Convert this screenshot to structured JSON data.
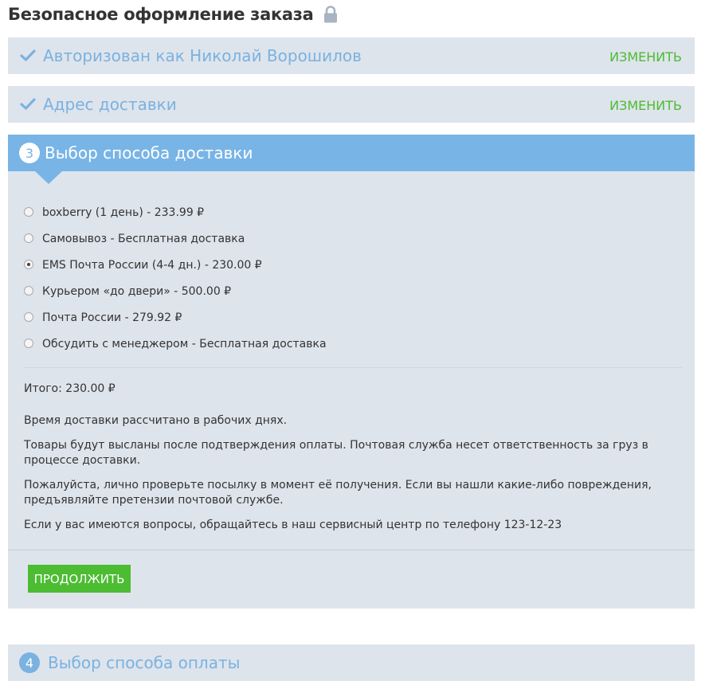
{
  "page": {
    "title": "Безопасное оформление заказа",
    "lock_icon": "lock-icon"
  },
  "steps": {
    "auth": {
      "title": "Авторизован как Николай Ворошилов",
      "edit_label": "ИЗМЕНИТЬ",
      "icon": "check-icon"
    },
    "address": {
      "title": "Адрес доставки",
      "edit_label": "ИЗМЕНИТЬ",
      "icon": "check-icon"
    },
    "delivery": {
      "number": "3",
      "title": "Выбор способа доставки",
      "options": [
        {
          "label": "boxberry (1 день) - 233.99 ₽",
          "selected": false
        },
        {
          "label": "Самовывоз - Бесплатная доставка",
          "selected": false
        },
        {
          "label": "EMS Почта России (4-4 дн.) - 230.00 ₽",
          "selected": true
        },
        {
          "label": "Курьером «до двери» - 500.00 ₽",
          "selected": false
        },
        {
          "label": "Почта России - 279.92 ₽",
          "selected": false
        },
        {
          "label": "Обсудить с менеджером - Бесплатная доставка",
          "selected": false
        }
      ],
      "total": "Итого: 230.00 ₽",
      "notes": [
        "Время доставки рассчитано в рабочих днях.",
        "Товары будут высланы после подтверждения оплаты. Почтовая служба несет ответственность за груз в процессе доставки.",
        "Пожалуйста, лично проверьте посылку в момент её получения. Если вы нашли какие-либо повреждения, предъявляйте претензии почтовой службе.",
        "Если у вас имеются вопросы, обращайтесь в наш сервисный центр по телефону 123-12-23"
      ],
      "continue_label": "ПРОДОЛЖИТЬ"
    },
    "payment": {
      "number": "4",
      "title": "Выбор способа оплаты"
    }
  },
  "colors": {
    "accent_blue": "#78b4e6",
    "text_blue": "#7ab2e0",
    "green": "#4cbc32",
    "panel_bg": "#dee4ec"
  }
}
